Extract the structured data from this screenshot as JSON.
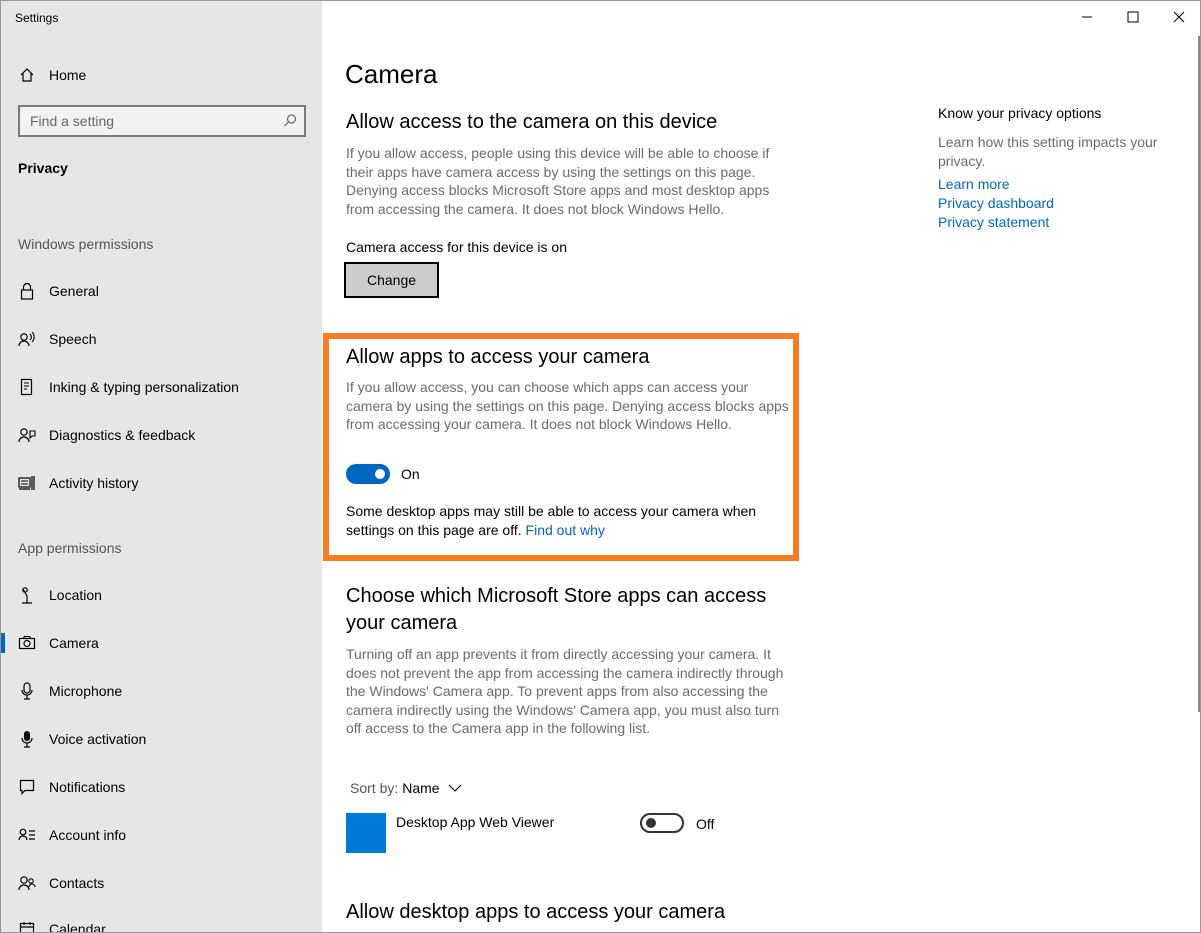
{
  "window": {
    "title": "Settings"
  },
  "sidebar": {
    "home_label": "Home",
    "search_placeholder": "Find a setting",
    "section_title": "Privacy",
    "windows_permissions_label": "Windows permissions",
    "app_permissions_label": "App permissions",
    "windows_items": [
      {
        "label": "General",
        "icon": "lock-icon"
      },
      {
        "label": "Speech",
        "icon": "speech-icon"
      },
      {
        "label": "Inking & typing personalization",
        "icon": "inking-icon"
      },
      {
        "label": "Diagnostics & feedback",
        "icon": "diagnostics-icon"
      },
      {
        "label": "Activity history",
        "icon": "activity-history-icon"
      }
    ],
    "app_items": [
      {
        "label": "Location",
        "icon": "location-icon"
      },
      {
        "label": "Camera",
        "icon": "camera-icon",
        "selected": true
      },
      {
        "label": "Microphone",
        "icon": "microphone-icon"
      },
      {
        "label": "Voice activation",
        "icon": "voice-activation-icon"
      },
      {
        "label": "Notifications",
        "icon": "notifications-icon"
      },
      {
        "label": "Account info",
        "icon": "account-info-icon"
      },
      {
        "label": "Contacts",
        "icon": "contacts-icon"
      },
      {
        "label": "Calendar",
        "icon": "calendar-icon"
      }
    ]
  },
  "main": {
    "page_title": "Camera",
    "device_section": {
      "heading": "Allow access to the camera on this device",
      "description": "If you allow access, people using this device will be able to choose if their apps have camera access by using the settings on this page. Denying access blocks Microsoft Store apps and most desktop apps from accessing the camera. It does not block Windows Hello.",
      "status": "Camera access for this device is on",
      "change_button": "Change"
    },
    "apps_section": {
      "heading": "Allow apps to access your camera",
      "description": "If you allow access, you can choose which apps can access your camera by using the settings on this page. Denying access blocks apps from accessing your camera. It does not block Windows Hello.",
      "toggle_state": "On",
      "note": "Some desktop apps may still be able to access your camera when settings on this page are off.",
      "note_link": "Find out why"
    },
    "store_section": {
      "heading_line1": "Choose which Microsoft Store apps can access",
      "heading_line2": "your camera",
      "description": "Turning off an app prevents it from directly accessing your camera. It does not prevent the app from accessing the camera indirectly through the Windows' Camera app. To prevent apps from also accessing the camera indirectly using the Windows' Camera app, you must also turn off access to the Camera app in the following list.",
      "sort_label": "Sort by:",
      "sort_value": "Name",
      "apps": [
        {
          "name": "Desktop App Web Viewer",
          "state": "Off",
          "tile_color": "#0078d7"
        }
      ]
    },
    "desktop_section": {
      "heading": "Allow desktop apps to access your camera"
    }
  },
  "right_panel": {
    "title": "Know your privacy options",
    "description": "Learn how this setting impacts your privacy.",
    "links": [
      "Learn more",
      "Privacy dashboard",
      "Privacy statement"
    ]
  },
  "colors": {
    "accent": "#0067c0",
    "highlight": "#f77b1f",
    "sidebar_bg": "#e6e6e6"
  }
}
